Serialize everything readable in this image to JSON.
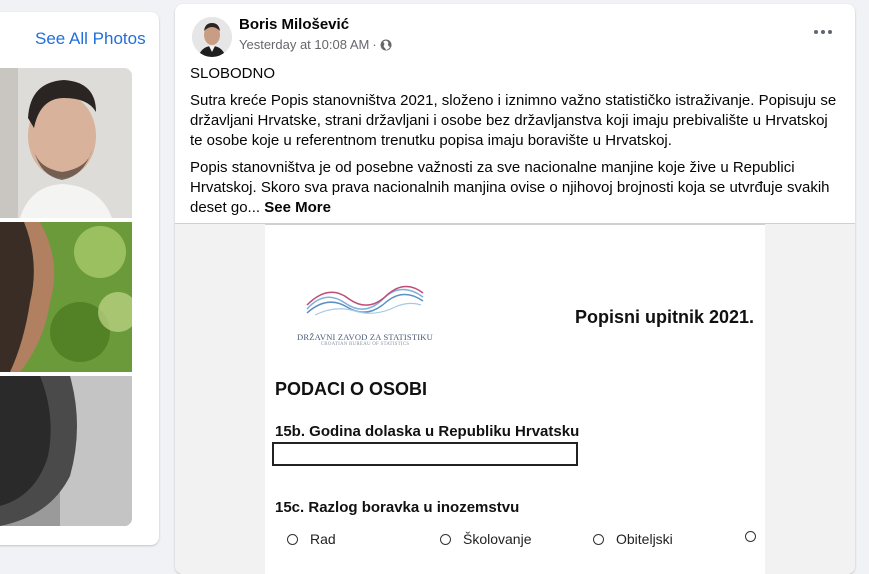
{
  "sidebar": {
    "see_all_photos": "See All Photos"
  },
  "post": {
    "author": "Boris Milošević",
    "timestamp": "Yesterday at 10:08 AM",
    "separator": "·",
    "text": {
      "p1": "SLOBODNO",
      "p2": "Sutra kreće Popis stanovništva 2021, složeno i iznimno važno statističko istraživanje. Popisuju se državljani Hrvatske, strani državljani i osobe bez državljanstva koji imaju prebivalište u Hrvatskoj te osobe koje u referentnom trenutku popisa imaju boravište u Hrvatskoj.",
      "p3": "Popis stanovništva je od posebne važnosti za sve nacionalne manjine koje žive u Republici Hrvatskoj. Skoro sva prava nacionalnih manjina ovise o njihovoj brojnosti koja se utvrđuje svakih deset go...",
      "see_more": "See More"
    }
  },
  "document": {
    "logo_text": "DRŽAVNI ZAVOD ZA STATISTIKU",
    "logo_subtext": "CROATIAN BUREAU OF STATISTICS",
    "title": "Popisni upitnik 2021.",
    "section_title": "PODACI O OSOBI",
    "q15b_label": "15b. Godina dolaska u Republiku Hrvatsku",
    "q15c_label": "15c. Razlog boravka u inozemstvu",
    "options": [
      "Rad",
      "Školovanje",
      "Obiteljski"
    ]
  },
  "colors": {
    "link": "#216fdb",
    "background": "#f0f2f5",
    "meta_text": "#65676b"
  },
  "icons": [
    "globe-icon",
    "more-options-icon"
  ]
}
